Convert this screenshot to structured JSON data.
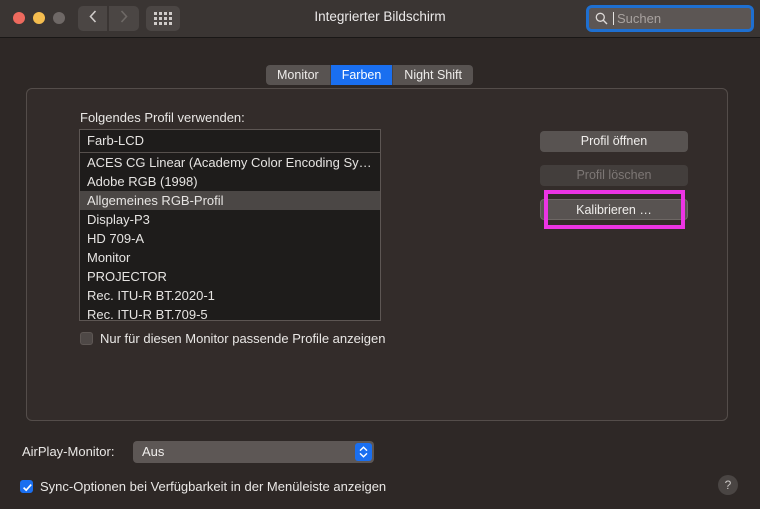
{
  "window": {
    "title": "Integrierter Bildschirm",
    "traffic_lights": [
      "close",
      "minimize",
      "zoom"
    ],
    "nav": {
      "back_icon": "chevron-left-icon",
      "forward_icon": "chevron-right-icon",
      "grid_icon": "grid-dots-icon"
    }
  },
  "search": {
    "placeholder": "Suchen",
    "value": "",
    "icon": "search-icon",
    "focus_color": "#1e6fd0"
  },
  "tabs": [
    {
      "label": "Monitor",
      "selected": false
    },
    {
      "label": "Farben",
      "selected": true
    },
    {
      "label": "Night Shift",
      "selected": false
    }
  ],
  "profile_section": {
    "label": "Folgendes Profil verwenden:",
    "list_header": "Farb-LCD",
    "items": [
      {
        "label": "ACES CG Linear (Academy Color Encoding Sy…",
        "selected": false
      },
      {
        "label": "Adobe RGB (1998)",
        "selected": false
      },
      {
        "label": "Allgemeines RGB-Profil",
        "selected": true
      },
      {
        "label": "Display-P3",
        "selected": false
      },
      {
        "label": "HD 709-A",
        "selected": false
      },
      {
        "label": "Monitor",
        "selected": false
      },
      {
        "label": "PROJECTOR",
        "selected": false
      },
      {
        "label": "Rec. ITU-R BT.2020-1",
        "selected": false
      },
      {
        "label": "Rec. ITU-R BT.709-5",
        "selected": false
      }
    ],
    "filter_checkbox": {
      "label": "Nur für diesen Monitor passende Profile anzeigen",
      "checked": false
    }
  },
  "buttons": {
    "open_profile": "Profil öffnen",
    "delete_profile": "Profil löschen",
    "calibrate": "Kalibrieren …",
    "highlight_color": "#ec34e4"
  },
  "airplay": {
    "label": "AirPlay-Monitor:",
    "selected": "Aus",
    "options": [
      "Aus"
    ],
    "chevron_icon": "chevron-up-down-icon",
    "accent_color": "#1a6ff0"
  },
  "sync_checkbox": {
    "label": "Sync-Optionen bei Verfügbarkeit in der Menüleiste anzeigen",
    "checked": true
  },
  "help": {
    "label": "?",
    "icon": "question-mark-icon"
  }
}
